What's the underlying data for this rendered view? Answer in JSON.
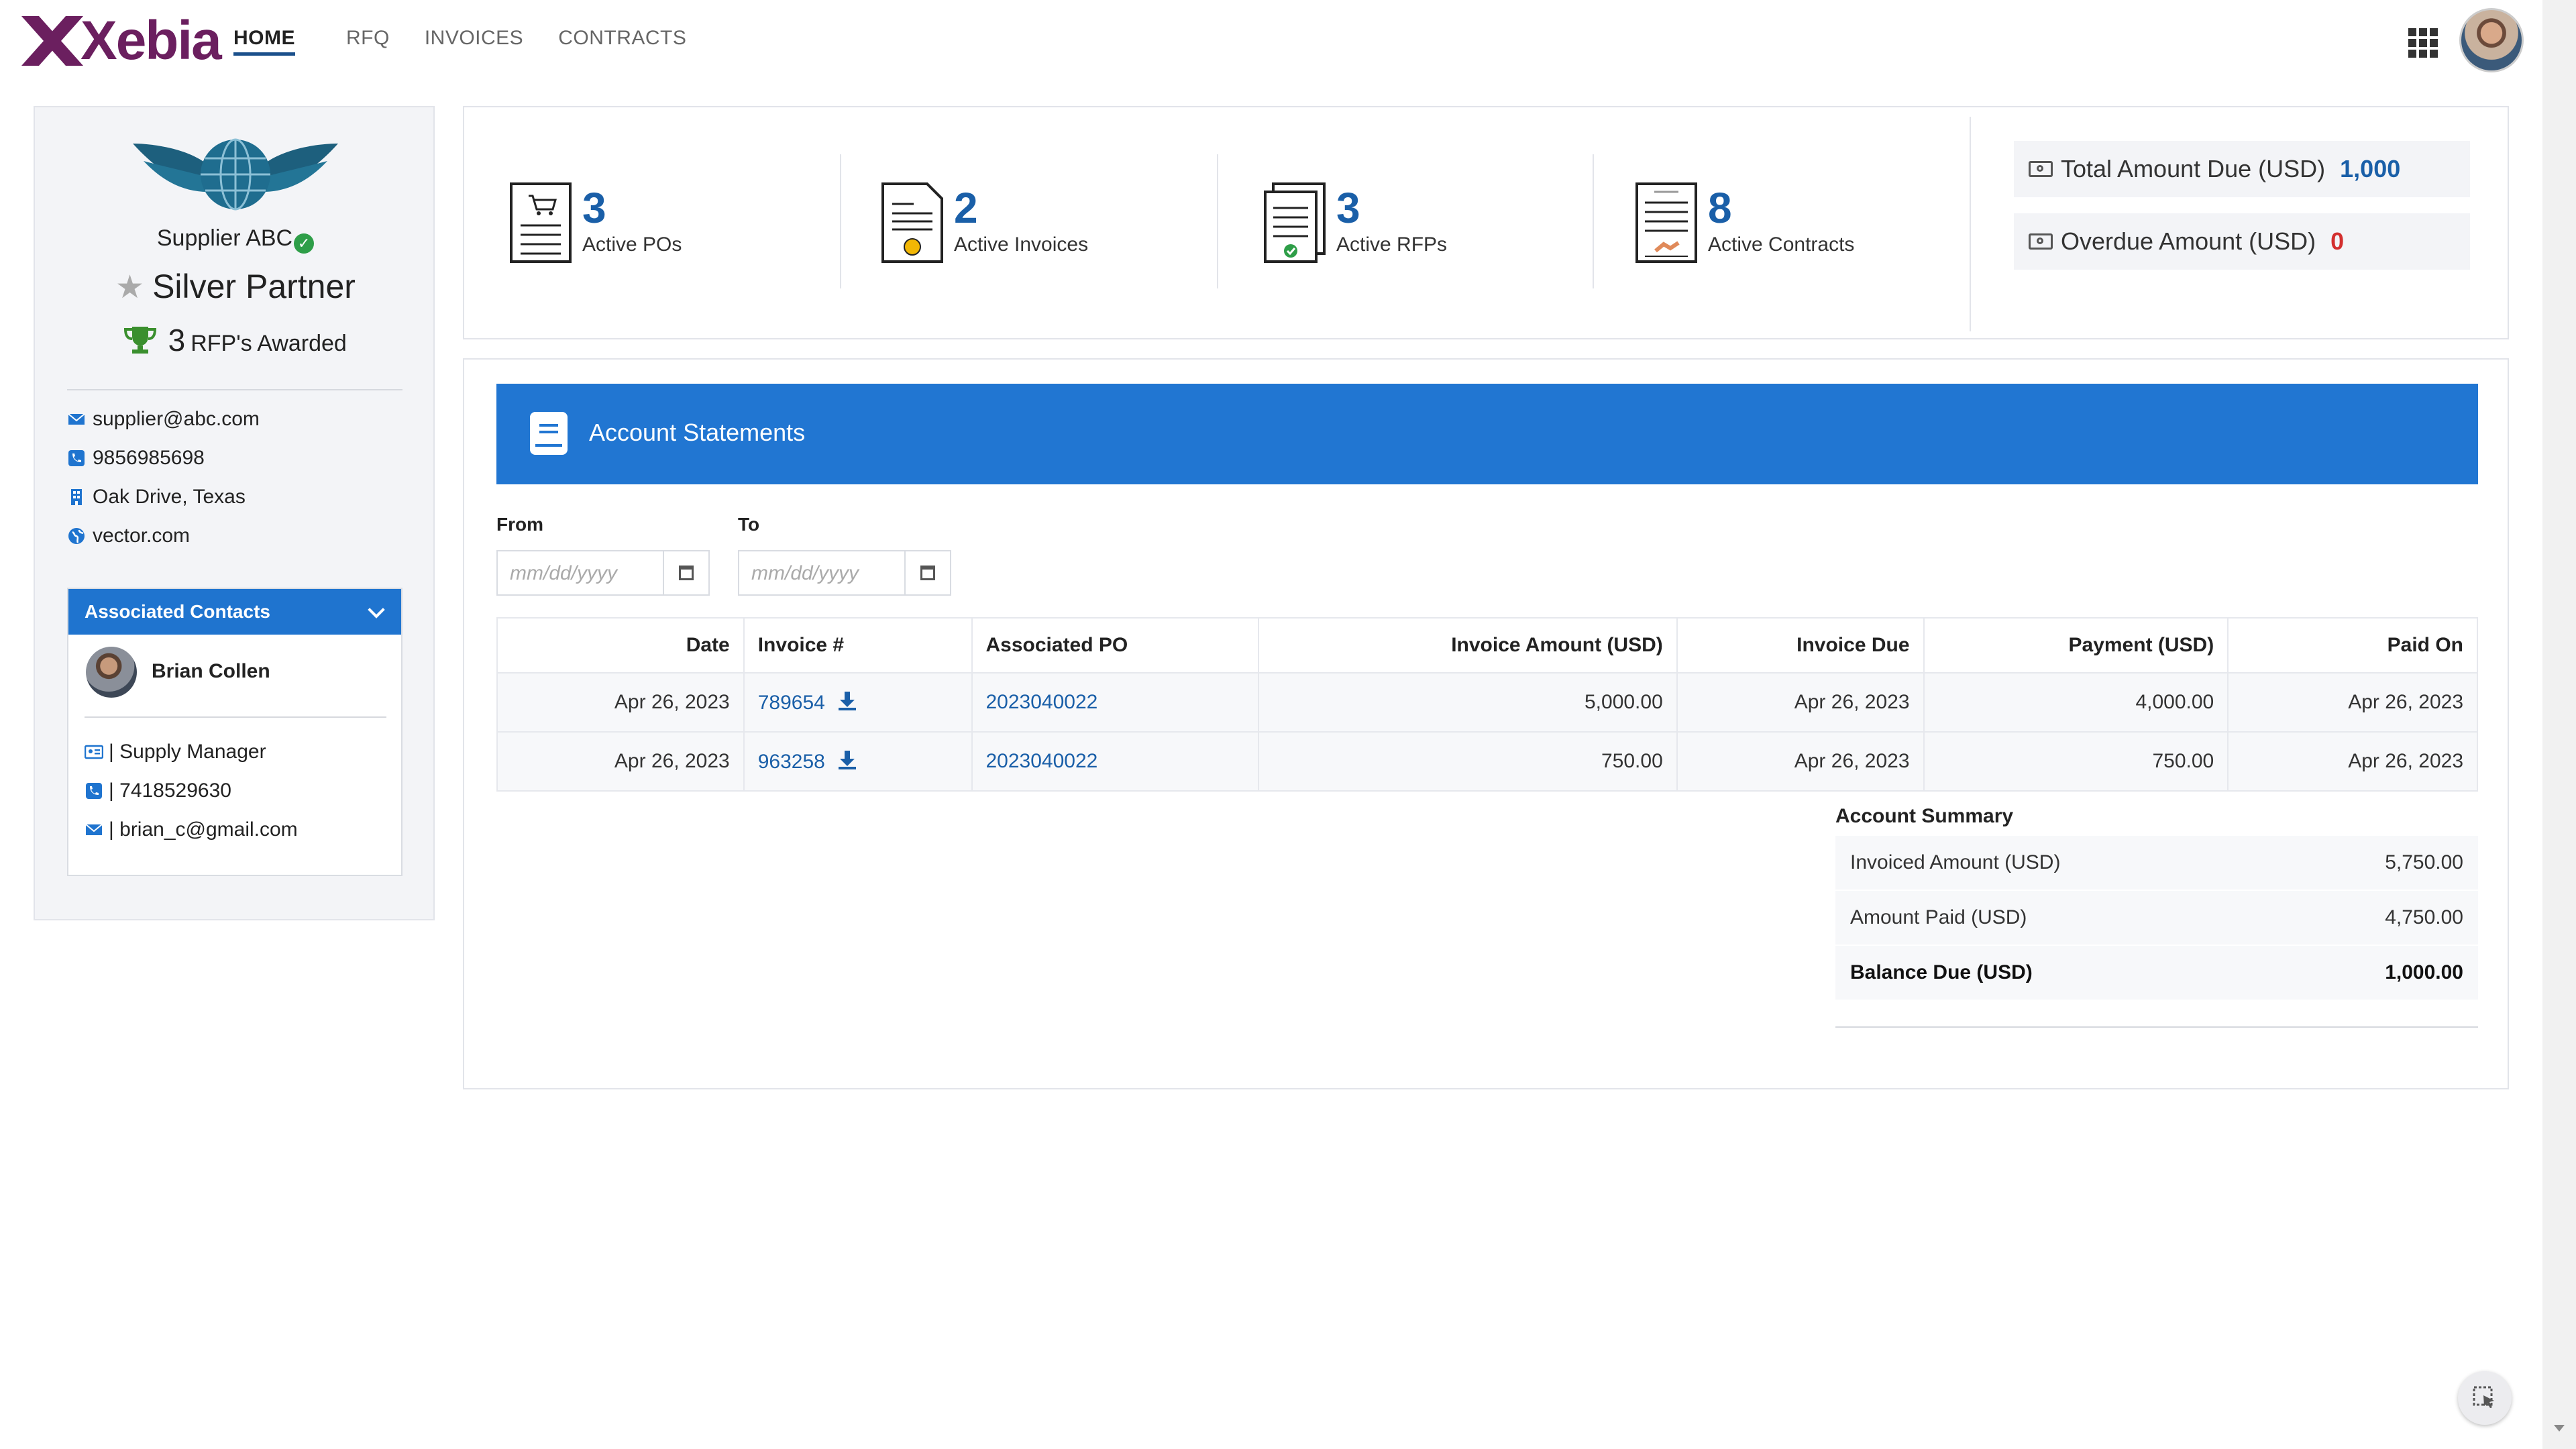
{
  "app": {
    "logo_text": "Xebia",
    "brand_color": "#6b1f5f",
    "accent_color": "#2176d2"
  },
  "nav": {
    "items": [
      {
        "label": "HOME",
        "active": true
      },
      {
        "label": "RFQ",
        "active": false
      },
      {
        "label": "INVOICES",
        "active": false
      },
      {
        "label": "CONTRACTS",
        "active": false
      }
    ],
    "apps_icon": "grid-icon",
    "avatar_icon": "user-avatar"
  },
  "profile": {
    "supplier_name": "Supplier ABC",
    "tier": "Silver Partner",
    "rfps_awarded_count": "3",
    "rfps_awarded_label": "RFP's Awarded",
    "email": "supplier@abc.com",
    "phone": "9856985698",
    "address": "Oak Drive, Texas",
    "website": "vector.com"
  },
  "associated_contacts": {
    "title": "Associated Contacts",
    "contact": {
      "name": "Brian Collen",
      "role": "| Supply Manager",
      "phone": "| 7418529630",
      "email": "| brian_c@gmail.com"
    }
  },
  "stats": {
    "active_pos": {
      "value": "3",
      "label": "Active POs"
    },
    "active_invoices": {
      "value": "2",
      "label": "Active Invoices"
    },
    "active_rfps": {
      "value": "3",
      "label": "Active RFPs"
    },
    "active_contracts": {
      "value": "8",
      "label": "Active Contracts"
    }
  },
  "amounts": {
    "total_due_label": "Total Amount Due (USD)",
    "total_due_value": "1,000",
    "total_due_color": "#1a5fa8",
    "overdue_label": "Overdue Amount (USD)",
    "overdue_value": "0",
    "overdue_color": "#d32f2f"
  },
  "statements": {
    "title": "Account Statements",
    "from_label": "From",
    "to_label": "To",
    "date_placeholder": "mm/dd/yyyy",
    "columns": [
      "Date",
      "Invoice #",
      "Associated PO",
      "Invoice Amount (USD)",
      "Invoice Due",
      "Payment (USD)",
      "Paid On"
    ],
    "rows": [
      {
        "date": "Apr 26, 2023",
        "invoice": "789654",
        "po": "2023040022",
        "amount": "5,000.00",
        "due": "Apr 26, 2023",
        "payment": "4,000.00",
        "paid_on": "Apr 26, 2023"
      },
      {
        "date": "Apr 26, 2023",
        "invoice": "963258",
        "po": "2023040022",
        "amount": "750.00",
        "due": "Apr 26, 2023",
        "payment": "750.00",
        "paid_on": "Apr 26, 2023"
      }
    ]
  },
  "summary": {
    "title": "Account Summary",
    "invoiced_label": "Invoiced Amount (USD)",
    "invoiced_value": "5,750.00",
    "paid_label": "Amount Paid (USD)",
    "paid_value": "4,750.00",
    "balance_label": "Balance Due (USD)",
    "balance_value": "1,000.00"
  }
}
